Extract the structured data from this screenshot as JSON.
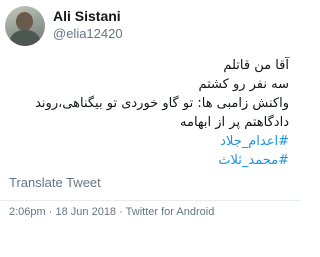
{
  "author": {
    "name": "Ali Sistani",
    "handle": "@elia12420"
  },
  "tweet": {
    "lines": [
      "آقا من قاتلم",
      "سه نفر رو کشتم",
      "واکنش زامبی ها: تو گاو خوردی تو بیگناهی،روند",
      "دادگاهتم پر از ابهامه"
    ],
    "hashtags": [
      "#اعدام_جلاد",
      "#محمد_ثلاث"
    ]
  },
  "translate_label": "Translate Tweet",
  "meta": {
    "time": "2:06pm",
    "separator": "·",
    "date": "18 Jun 2018",
    "client": "Twitter for Android"
  },
  "colors": {
    "hashtag": "#1b95e0",
    "secondary_text": "#657786",
    "primary_text": "#14171a"
  }
}
